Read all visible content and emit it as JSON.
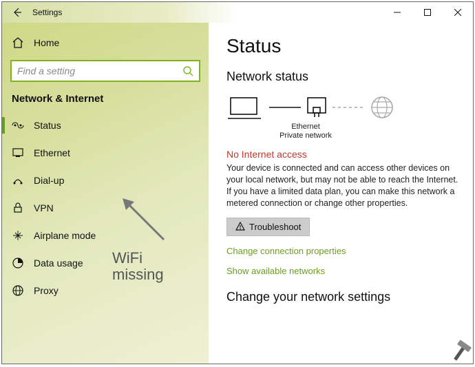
{
  "window": {
    "title": "Settings"
  },
  "sidebar": {
    "home": "Home",
    "search_placeholder": "Find a setting",
    "category": "Network & Internet",
    "items": [
      {
        "label": "Status"
      },
      {
        "label": "Ethernet"
      },
      {
        "label": "Dial-up"
      },
      {
        "label": "VPN"
      },
      {
        "label": "Airplane mode"
      },
      {
        "label": "Data usage"
      },
      {
        "label": "Proxy"
      }
    ]
  },
  "content": {
    "title": "Status",
    "subtitle": "Network status",
    "diagram": {
      "conn_name": "Ethernet",
      "conn_type": "Private network"
    },
    "alert": "No Internet access",
    "description": "Your device is connected and can access other devices on your local network, but may not be able to reach the Internet. If you have a limited data plan, you can make this network a metered connection or change other properties.",
    "troubleshoot": "Troubleshoot",
    "link1": "Change connection properties",
    "link2": "Show available networks",
    "section2": "Change your network settings"
  },
  "annotation": {
    "line1": "WiFi",
    "line2": "missing"
  }
}
